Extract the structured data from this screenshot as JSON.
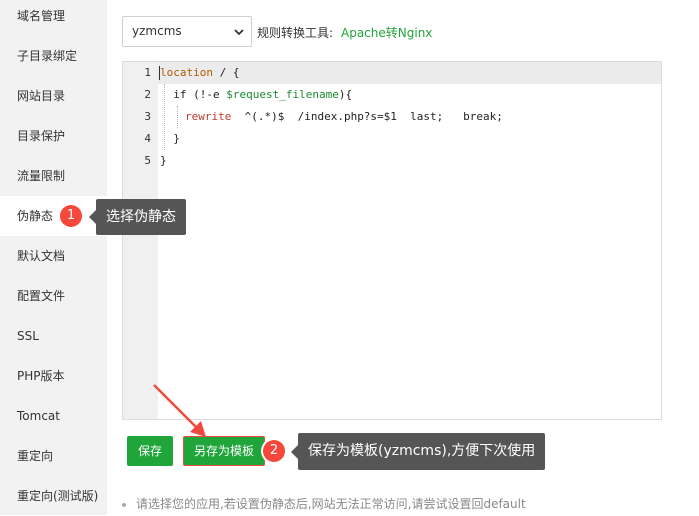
{
  "sidebar": {
    "items": [
      {
        "label": "域名管理"
      },
      {
        "label": "子目录绑定"
      },
      {
        "label": "网站目录"
      },
      {
        "label": "目录保护"
      },
      {
        "label": "流量限制"
      },
      {
        "label": "伪静态"
      },
      {
        "label": "默认文档"
      },
      {
        "label": "配置文件"
      },
      {
        "label": "SSL"
      },
      {
        "label": "PHP版本"
      },
      {
        "label": "Tomcat"
      },
      {
        "label": "重定向"
      },
      {
        "label": "重定向(测试版)"
      }
    ],
    "active_index": 5
  },
  "rewrite": {
    "template_select": "yzmcms",
    "rule_label": "规则转换工具:",
    "rule_link": "Apache转Nginx"
  },
  "editor": {
    "line_numbers": [
      "1",
      "2",
      "3",
      "4",
      "5"
    ],
    "code": {
      "line1": {
        "keyword": "location",
        "rest": " / {"
      },
      "line2": {
        "prefix": "  if (!-e ",
        "var": "$request_filename",
        "suffix": "){"
      },
      "line3": {
        "directive": "rewrite",
        "rest": "  ^(.*)$  /index.php?s=$1  last;   break;"
      },
      "line4": {
        "text": "  }"
      },
      "line5": {
        "text": "}"
      }
    }
  },
  "buttons": {
    "save": "保存",
    "save_as_template": "另存为模板"
  },
  "annotations": [
    {
      "number": "1",
      "text": "选择伪静态"
    },
    {
      "number": "2",
      "text": "保存为模板(yzmcms),方便下次使用"
    }
  ],
  "hint": "请选择您的应用,若设置伪静态后,网站无法正常访问,请尝试设置回default",
  "colors": {
    "accent_green": "#20a53a",
    "badge_red": "#f5473a",
    "tooltip_gray": "#555555"
  }
}
